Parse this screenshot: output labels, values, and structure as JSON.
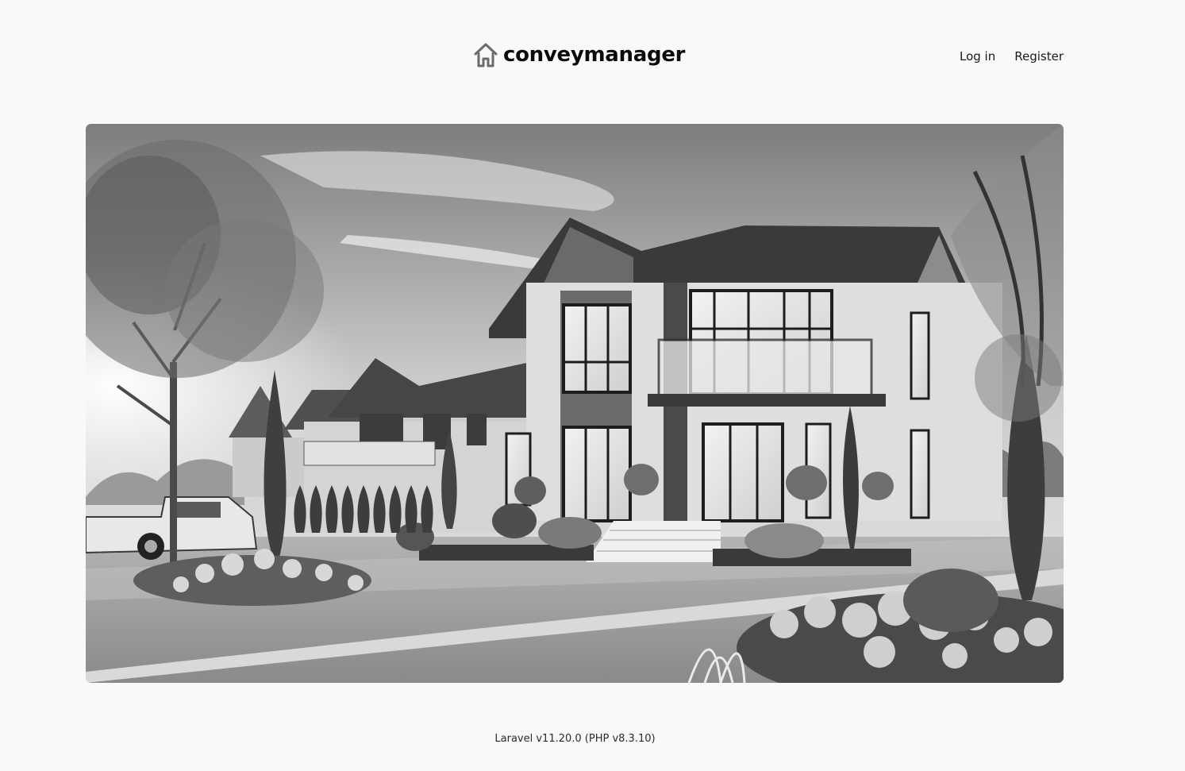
{
  "header": {
    "brand_name": "conveymanager",
    "brand_icon": "house-icon",
    "nav": {
      "login_label": "Log in",
      "register_label": "Register"
    }
  },
  "hero": {
    "image": "hero-house-illustration",
    "alt": "Grayscale illustration of a modern two-story house with front garden and neighboring houses"
  },
  "footer": {
    "version_text": "Laravel v11.20.0 (PHP v8.3.10)"
  },
  "colors": {
    "background": "#f8f9fb",
    "text": "#111111",
    "icon": "#6b6b6b"
  }
}
